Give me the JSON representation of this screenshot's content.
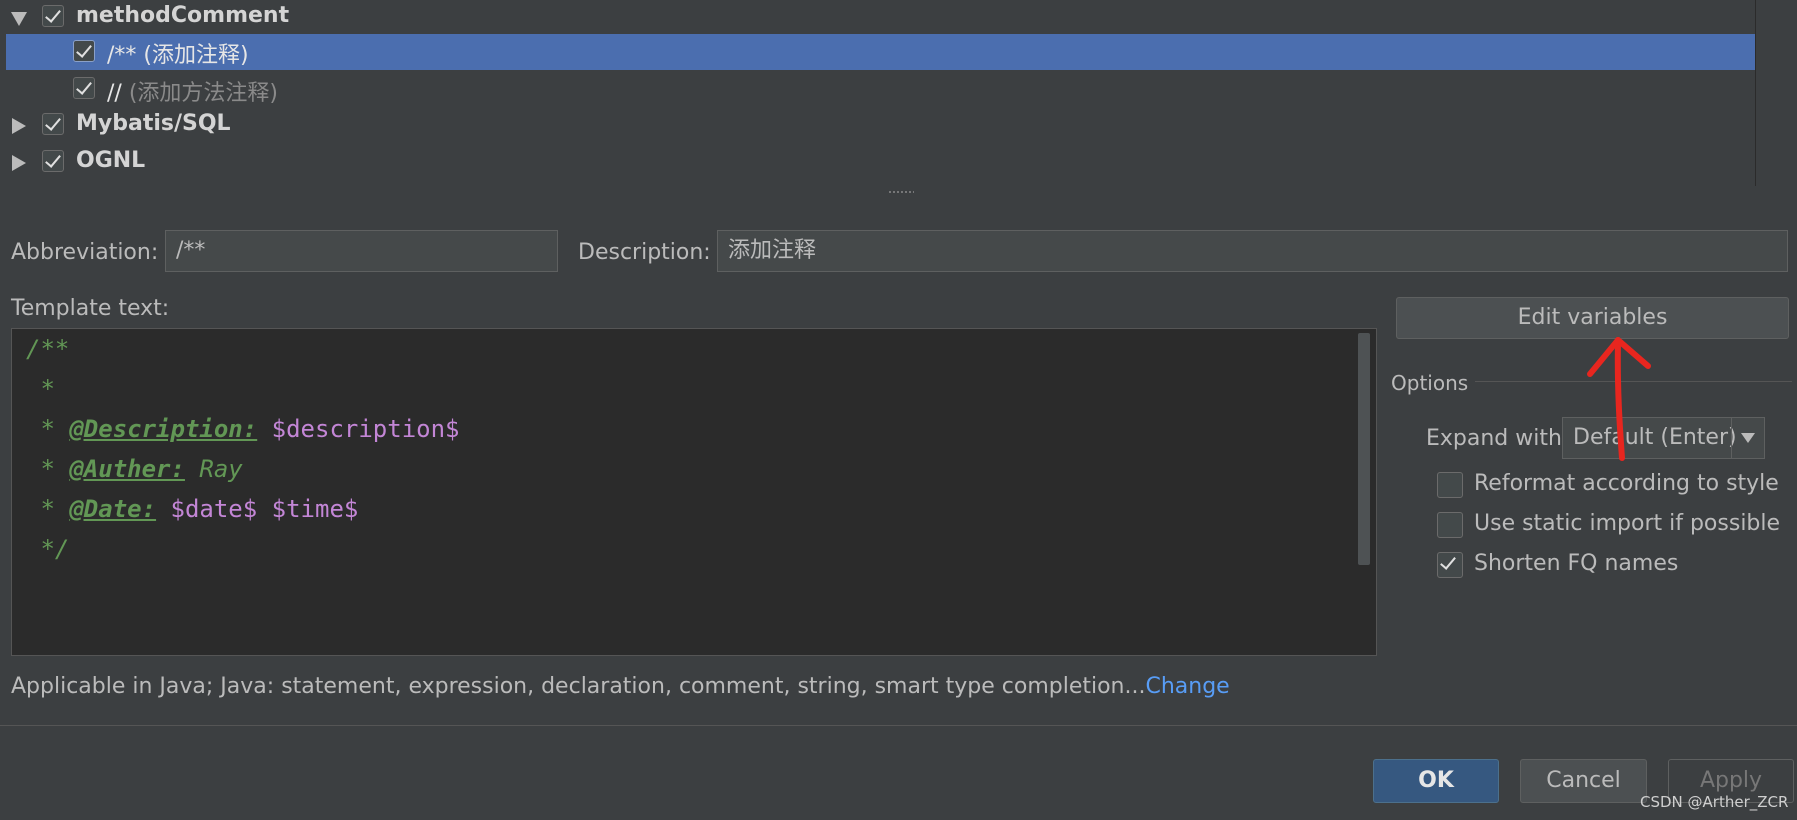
{
  "tree": {
    "rows": [
      {
        "label": "methodComment",
        "expanded": true,
        "checked": true
      },
      {
        "label": "/** (添加注释)",
        "checked": true,
        "selected": true
      },
      {
        "label_main": "// ",
        "label_sub": "(添加方法注释)",
        "checked": true
      },
      {
        "label": "Mybatis/SQL",
        "expanded": false,
        "checked": true
      },
      {
        "label": "OGNL",
        "expanded": false,
        "checked": true
      }
    ]
  },
  "form": {
    "abbreviation_label": "Abbreviation:",
    "abbreviation_value": "/**",
    "description_label": "Description:",
    "description_value": "添加注释",
    "template_label": "Template text:"
  },
  "template_lines": [
    {
      "c1": "/**"
    },
    {
      "c1": " *"
    },
    {
      "c1": " * ",
      "tag": "@Description:",
      "var": " $description$"
    },
    {
      "c1": " * ",
      "tag": "@Auther:",
      "plain": " Ray"
    },
    {
      "c1": " * ",
      "tag": "@Date:",
      "var": " $date$ $time$"
    },
    {
      "c1": " */"
    }
  ],
  "right_panel": {
    "edit_variables": "Edit variables",
    "options_title": "Options",
    "expand_label": "Expand with",
    "expand_value": "Default (Enter)",
    "checkboxes": [
      {
        "label": "Reformat according to style",
        "checked": false
      },
      {
        "label": "Use static import if possible",
        "checked": false
      },
      {
        "label": "Shorten FQ names",
        "checked": true
      }
    ]
  },
  "applicable": {
    "text": "Applicable in Java; Java: statement, expression, declaration, comment, string, smart type completion...",
    "change": "Change"
  },
  "buttons": {
    "ok": "OK",
    "cancel": "Cancel",
    "apply": "Apply"
  },
  "watermark": "CSDN @Arther_ZCR",
  "colors": {
    "selection": "#4b6eaf",
    "link": "#589df6",
    "comment": "#629755",
    "variable": "#c386d6",
    "annotation": "#e8261f"
  }
}
